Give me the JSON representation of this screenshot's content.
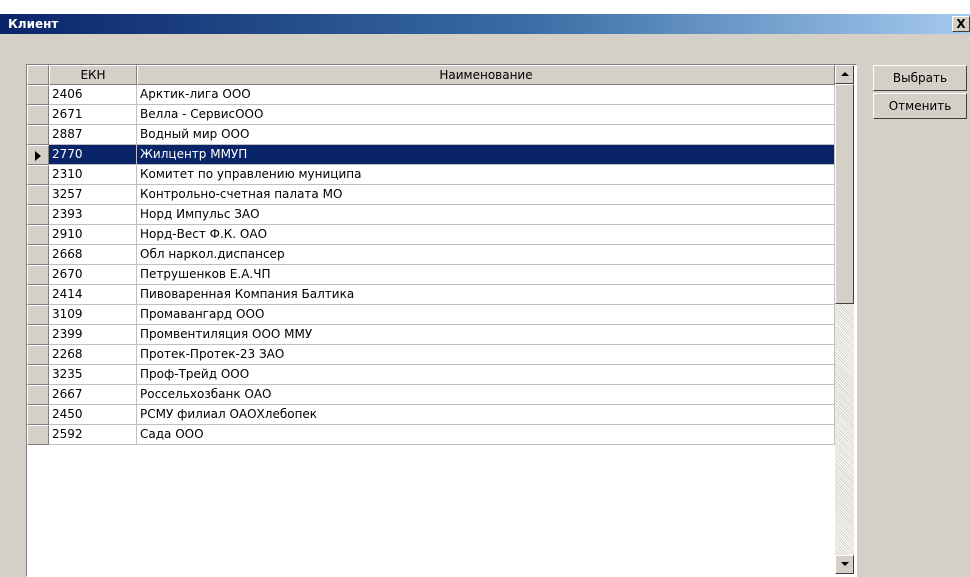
{
  "window": {
    "title": "Клиент",
    "close_label": "X"
  },
  "grid": {
    "columns": {
      "ekh": "ЕКН",
      "name": "Наименование"
    },
    "rows": [
      {
        "ekh": "2406",
        "name": "Арктик-лига ООО"
      },
      {
        "ekh": "2671",
        "name": "Велла - СервисООО"
      },
      {
        "ekh": "2887",
        "name": "Водный мир ООО"
      },
      {
        "ekh": "2770",
        "name": "Жилцентр ММУП",
        "selected": true
      },
      {
        "ekh": "2310",
        "name": "Комитет по управлению муниципа"
      },
      {
        "ekh": "3257",
        "name": "Контрольно-счетная палата МО"
      },
      {
        "ekh": "2393",
        "name": "Норд Импульс ЗАО"
      },
      {
        "ekh": "2910",
        "name": "Норд-Вест Ф.К. ОАО"
      },
      {
        "ekh": "2668",
        "name": "Обл наркол.диспансер"
      },
      {
        "ekh": "2670",
        "name": "Петрушенков Е.А.ЧП"
      },
      {
        "ekh": "2414",
        "name": "Пивоваренная Компания Балтика"
      },
      {
        "ekh": "3109",
        "name": "Промавангард ООО"
      },
      {
        "ekh": "2399",
        "name": "Промвентиляция ООО ММУ"
      },
      {
        "ekh": "2268",
        "name": "Протек-Протек-23 ЗАО"
      },
      {
        "ekh": "3235",
        "name": "Проф-Трейд ООО"
      },
      {
        "ekh": "2667",
        "name": "Россельхозбанк ОАО"
      },
      {
        "ekh": "2450",
        "name": "РСМУ филиал ОАОХлебопек"
      },
      {
        "ekh": "2592",
        "name": "Сада ООО"
      }
    ]
  },
  "buttons": {
    "select": "Выбрать",
    "cancel": "Отменить"
  },
  "colors": {
    "title_bar": "#0a246a",
    "selection": "#0a246a",
    "face": "#d4d0c8"
  }
}
